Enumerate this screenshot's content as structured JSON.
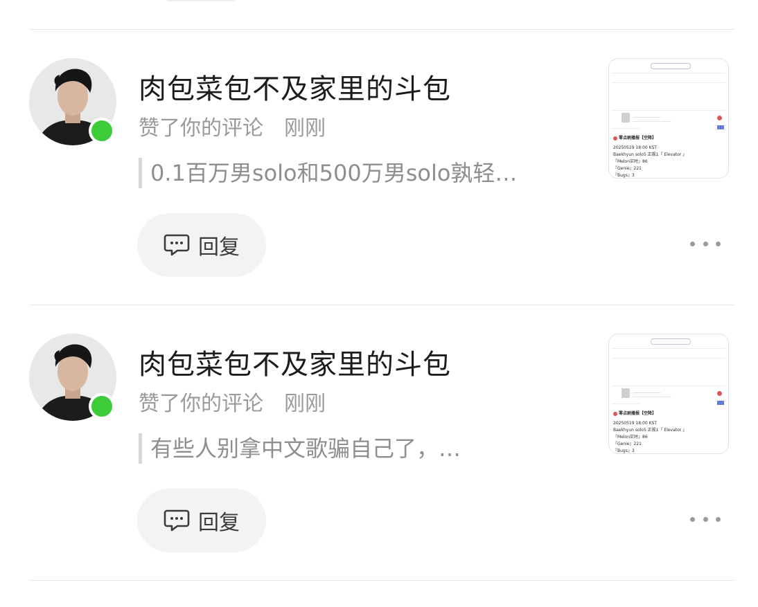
{
  "notifications": [
    {
      "username": "肉包菜包不及家里的斗包",
      "action": "赞了你的评论",
      "time": "刚刚",
      "quote": "0.1百万男solo和500万男solo孰轻…",
      "reply_label": "回复",
      "online": true,
      "thumbnail": {
        "lines": [
          "零点刷播报【空降】",
          "20250519 18:00 KST",
          "Baekhyun solo5 正规1『 Elevator 』",
          "『Melon实时』86",
          "『Genie』221",
          "『Bugs』3"
        ]
      }
    },
    {
      "username": "肉包菜包不及家里的斗包",
      "action": "赞了你的评论",
      "time": "刚刚",
      "quote": "有些人别拿中文歌骗自己了，…",
      "reply_label": "回复",
      "online": true,
      "thumbnail": {
        "lines": [
          "零点刷播报【空降】",
          "20250519 18:00 KST",
          "Baekhyun solo5 正规1『 Elevator 』",
          "『Melon实时』86",
          "『Genie』221",
          "『Bugs』3"
        ]
      }
    }
  ],
  "colors": {
    "online": "#3dcb3a",
    "divider": "#e6e6e6",
    "username": "#1c1c1c",
    "meta": "#9a9a9a",
    "reply_bg": "#f3f3f3"
  },
  "icons": {
    "reply": "comment-bubble-icon",
    "more": "more-dots-icon"
  }
}
